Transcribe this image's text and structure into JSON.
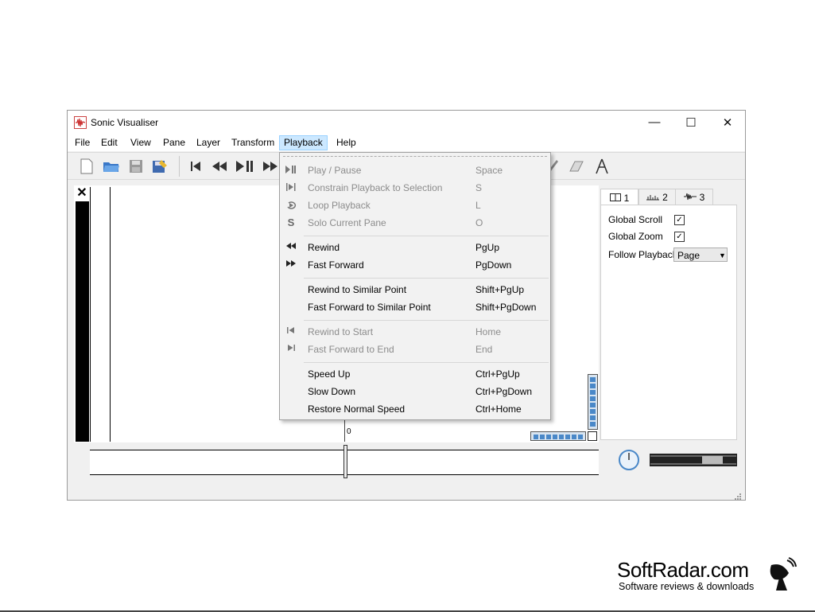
{
  "window": {
    "title": "Sonic Visualiser",
    "controls": {
      "minimize": "—",
      "maximize": "☐",
      "close": "✕"
    }
  },
  "menubar": [
    {
      "label": "File"
    },
    {
      "label": "Edit"
    },
    {
      "label": "View"
    },
    {
      "label": "Pane"
    },
    {
      "label": "Layer"
    },
    {
      "label": "Transform"
    },
    {
      "label": "Playback"
    },
    {
      "label": "Help"
    }
  ],
  "playback_menu": {
    "items": [
      {
        "icon": "play-pause-icon",
        "label": "Play / Pause",
        "shortcut": "Space",
        "enabled": false
      },
      {
        "icon": "constrain-icon",
        "label": "Constrain Playback to Selection",
        "shortcut": "S",
        "enabled": false
      },
      {
        "icon": "loop-icon",
        "label": "Loop Playback",
        "shortcut": "L",
        "enabled": false
      },
      {
        "icon": "solo-icon",
        "label": "Solo Current Pane",
        "shortcut": "O",
        "enabled": false
      },
      {
        "icon": "rewind-icon",
        "label": "Rewind",
        "shortcut": "PgUp",
        "enabled": true
      },
      {
        "icon": "fast-forward-icon",
        "label": "Fast Forward",
        "shortcut": "PgDown",
        "enabled": true
      },
      {
        "icon": "",
        "label": "Rewind to Similar Point",
        "shortcut": "Shift+PgUp",
        "enabled": true
      },
      {
        "icon": "",
        "label": "Fast Forward to Similar Point",
        "shortcut": "Shift+PgDown",
        "enabled": true
      },
      {
        "icon": "rewind-start-icon",
        "label": "Rewind to Start",
        "shortcut": "Home",
        "enabled": false
      },
      {
        "icon": "ffwd-end-icon",
        "label": "Fast Forward to End",
        "shortcut": "End",
        "enabled": false
      },
      {
        "icon": "",
        "label": "Speed Up",
        "shortcut": "Ctrl+PgUp",
        "enabled": true
      },
      {
        "icon": "",
        "label": "Slow Down",
        "shortcut": "Ctrl+PgDown",
        "enabled": true
      },
      {
        "icon": "",
        "label": "Restore Normal Speed",
        "shortcut": "Ctrl+Home",
        "enabled": true
      }
    ]
  },
  "right_panel": {
    "tabs": [
      {
        "icon": "pane-icon",
        "label": "1"
      },
      {
        "icon": "ruler-icon",
        "label": "2"
      },
      {
        "icon": "waveform-icon",
        "label": "3"
      }
    ],
    "global_scroll_label": "Global Scroll",
    "global_scroll_checked": true,
    "global_zoom_label": "Global Zoom",
    "global_zoom_checked": true,
    "follow_playback_label": "Follow Playback",
    "follow_playback_value": "Page"
  },
  "pane": {
    "time_marker": "0"
  },
  "watermark": {
    "brand": "SoftRadar.com",
    "tagline": "Software reviews & downloads"
  }
}
